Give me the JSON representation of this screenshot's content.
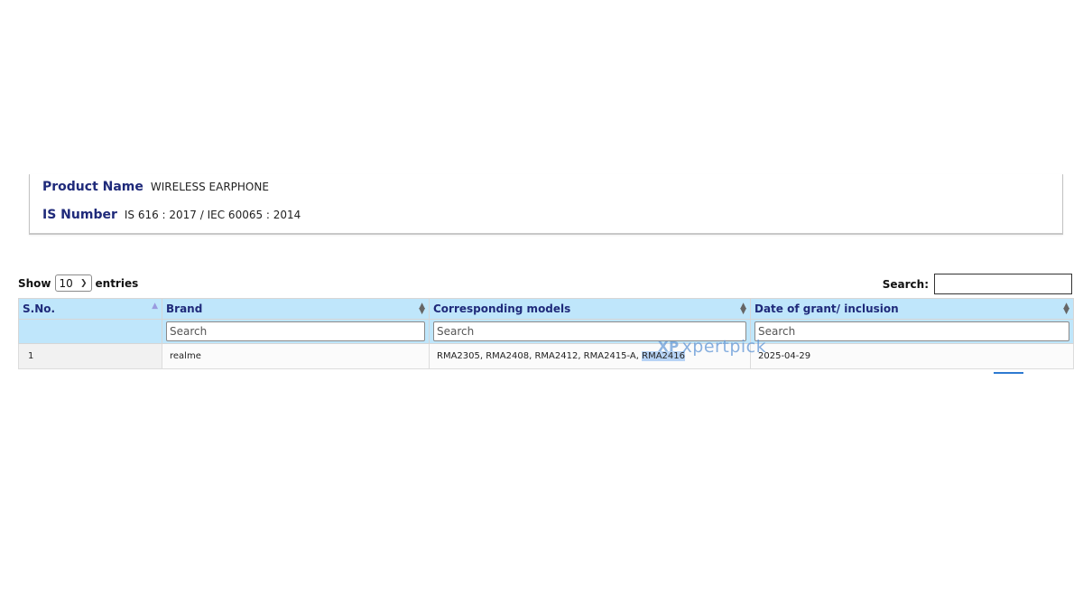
{
  "product": {
    "name_label": "Product Name",
    "name_value": "WIRELESS EARPHONE",
    "is_label": "IS Number",
    "is_value": "IS 616 : 2017 / IEC 60065 : 2014"
  },
  "controls": {
    "show_label": "Show",
    "entries_value": "10",
    "entries_label": "entries",
    "search_label": "Search:"
  },
  "table": {
    "columns": [
      "S.No.",
      "Brand",
      "Corresponding models",
      "Date of grant/ inclusion"
    ],
    "filter_placeholder": "Search",
    "rows": [
      {
        "sno": "1",
        "brand": "realme",
        "models_prefix": "RMA2305, RMA2408, RMA2412, RMA2415-A, ",
        "models_highlight": "RMA2416",
        "date": "2025-04-29"
      }
    ]
  },
  "watermark": {
    "mark": "XP",
    "text": "xpertpick"
  }
}
